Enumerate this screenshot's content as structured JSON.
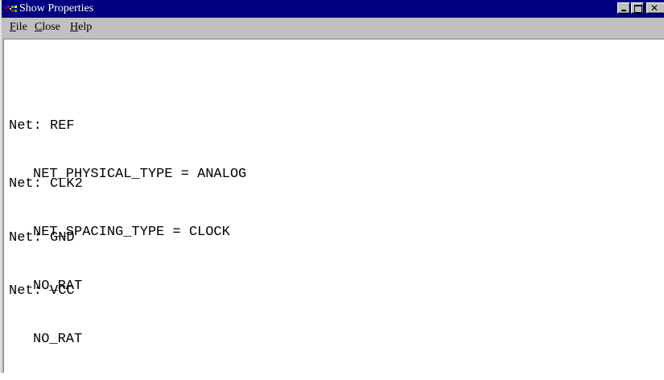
{
  "window": {
    "title": "Show Properties",
    "title_bar_color": "#000080",
    "icons": [
      "app-icon",
      "minimize-icon",
      "maximize-icon",
      "close-icon"
    ]
  },
  "menu": {
    "file": {
      "mnemonic": "F",
      "rest": "ile"
    },
    "close": {
      "mnemonic": "C",
      "rest": "lose"
    },
    "help": {
      "mnemonic": "H",
      "rest": "elp"
    }
  },
  "nets": [
    {
      "net": "Net: REF",
      "property": "NET_PHYSICAL_TYPE = ANALOG"
    },
    {
      "net": "Net: CLK2",
      "property": "NET_SPACING_TYPE = CLOCK"
    },
    {
      "net": "Net: GND",
      "property": "NO_RAT"
    },
    {
      "net": "Net: VCC",
      "property": "NO_RAT"
    }
  ]
}
